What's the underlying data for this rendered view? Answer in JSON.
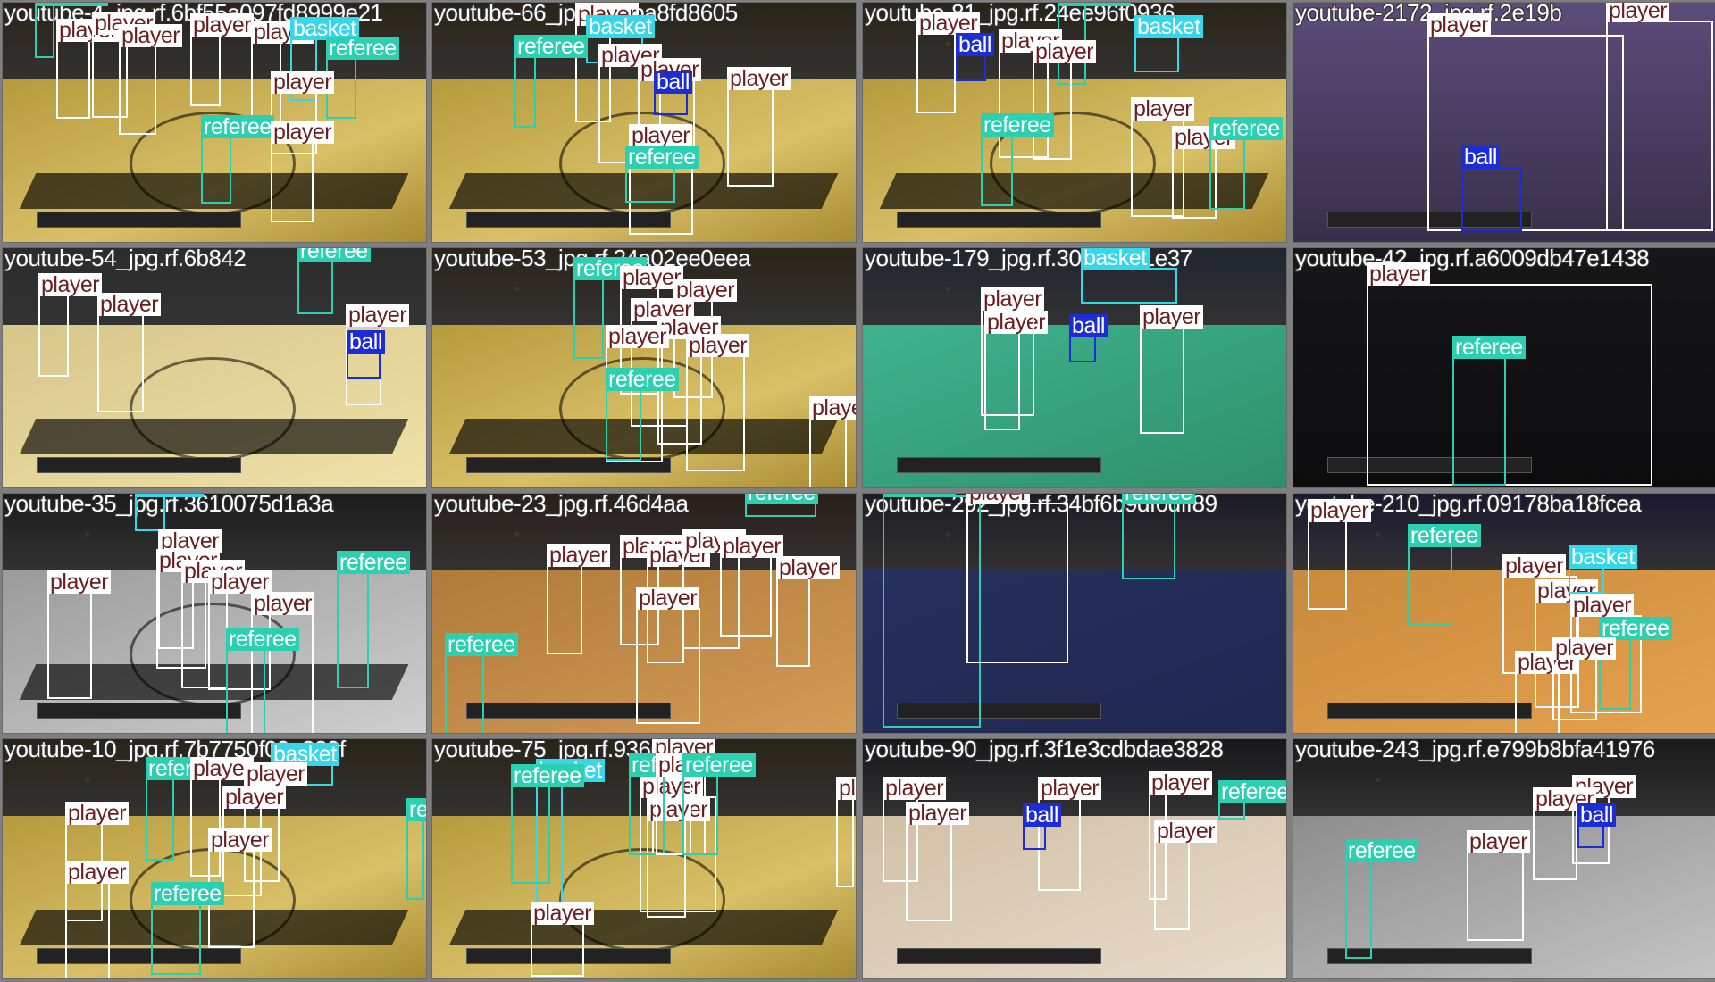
{
  "class_colors": {
    "player": "#ffffff",
    "referee": "#2ad0b0",
    "ball": "#1c2cd6",
    "basket": "#35d8e8"
  },
  "tiles": [
    {
      "name": "youtube-4_jpg.rf.6bf55a097fd8999e21",
      "theme": "gold",
      "detections": [
        {
          "cls": "referee",
          "label": "referee"
        },
        {
          "cls": "player",
          "label": "player"
        },
        {
          "cls": "player",
          "label": "player"
        },
        {
          "cls": "player",
          "label": "player"
        },
        {
          "cls": "player",
          "label": "player"
        },
        {
          "cls": "player",
          "label": "player"
        },
        {
          "cls": "basket",
          "label": "basket"
        },
        {
          "cls": "referee",
          "label": "referee"
        },
        {
          "cls": "player",
          "label": "player"
        },
        {
          "cls": "referee",
          "label": "referee"
        },
        {
          "cls": "player",
          "label": "player"
        }
      ]
    },
    {
      "name": "youtube-66_jpg.rf.dfba8fd8605",
      "theme": "gold",
      "detections": [
        {
          "cls": "player",
          "label": "player"
        },
        {
          "cls": "basket",
          "label": "basket"
        },
        {
          "cls": "referee",
          "label": "referee"
        },
        {
          "cls": "player",
          "label": "player"
        },
        {
          "cls": "player",
          "label": "player"
        },
        {
          "cls": "ball",
          "label": "ball"
        },
        {
          "cls": "player",
          "label": "player"
        },
        {
          "cls": "player",
          "label": "player"
        },
        {
          "cls": "referee",
          "label": "referee"
        }
      ]
    },
    {
      "name": "youtube-81_jpg.rf.24ee96f0936",
      "theme": "gold",
      "detections": [
        {
          "cls": "referee",
          "label": "referee"
        },
        {
          "cls": "player",
          "label": "player"
        },
        {
          "cls": "ball",
          "label": "ball"
        },
        {
          "cls": "player",
          "label": "player"
        },
        {
          "cls": "player",
          "label": "player"
        },
        {
          "cls": "basket",
          "label": "basket"
        },
        {
          "cls": "player",
          "label": "player"
        },
        {
          "cls": "referee",
          "label": "referee"
        },
        {
          "cls": "player",
          "label": "player"
        },
        {
          "cls": "referee",
          "label": "referee"
        }
      ]
    },
    {
      "name": "youtube-2172_jpg.rf.2e19b",
      "theme": "close",
      "detections": [
        {
          "cls": "player",
          "label": "player"
        },
        {
          "cls": "player",
          "label": "player"
        },
        {
          "cls": "ball",
          "label": "ball"
        }
      ]
    },
    {
      "name": "youtube-54_jpg.rf.6b842",
      "theme": "light",
      "detections": [
        {
          "cls": "referee",
          "label": "referee"
        },
        {
          "cls": "player",
          "label": "player"
        },
        {
          "cls": "player",
          "label": "player"
        },
        {
          "cls": "player",
          "label": "player"
        },
        {
          "cls": "ball",
          "label": "ball"
        }
      ]
    },
    {
      "name": "youtube-53_jpg.rf.24a02ee0eea",
      "theme": "gold",
      "detections": [
        {
          "cls": "referee",
          "label": "referee"
        },
        {
          "cls": "player",
          "label": "player"
        },
        {
          "cls": "player",
          "label": "player"
        },
        {
          "cls": "player",
          "label": "player"
        },
        {
          "cls": "player",
          "label": "player"
        },
        {
          "cls": "player",
          "label": "player"
        },
        {
          "cls": "player",
          "label": "player"
        },
        {
          "cls": "referee",
          "label": "referee"
        },
        {
          "cls": "player",
          "label": "player"
        }
      ]
    },
    {
      "name": "youtube-179_jpg.rf.3072cbd1e37",
      "theme": "green",
      "detections": [
        {
          "cls": "basket",
          "label": "basket"
        },
        {
          "cls": "player",
          "label": "player"
        },
        {
          "cls": "player",
          "label": "player"
        },
        {
          "cls": "ball",
          "label": "ball"
        },
        {
          "cls": "player",
          "label": "player"
        }
      ]
    },
    {
      "name": "youtube-42_jpg.rf.a6009db47e1438",
      "theme": "dark",
      "detections": [
        {
          "cls": "player",
          "label": "player"
        },
        {
          "cls": "referee",
          "label": "referee"
        }
      ]
    },
    {
      "name": "youtube-35_jpg.rf.3610075d1a3a",
      "theme": "gray",
      "detections": [
        {
          "cls": "basket",
          "label": "basket"
        },
        {
          "cls": "player",
          "label": "player"
        },
        {
          "cls": "player",
          "label": "player"
        },
        {
          "cls": "player",
          "label": "player"
        },
        {
          "cls": "referee",
          "label": "referee"
        },
        {
          "cls": "player",
          "label": "player"
        },
        {
          "cls": "player",
          "label": "player"
        },
        {
          "cls": "player",
          "label": "player"
        },
        {
          "cls": "referee",
          "label": "referee"
        }
      ]
    },
    {
      "name": "youtube-23_jpg.rf.46d4aa",
      "theme": "wood",
      "detections": [
        {
          "cls": "referee",
          "label": "referee"
        },
        {
          "cls": "player",
          "label": "player"
        },
        {
          "cls": "player",
          "label": "player"
        },
        {
          "cls": "player",
          "label": "player"
        },
        {
          "cls": "player",
          "label": "player"
        },
        {
          "cls": "player",
          "label": "player"
        },
        {
          "cls": "player",
          "label": "player"
        },
        {
          "cls": "player",
          "label": "player"
        },
        {
          "cls": "referee",
          "label": "referee"
        }
      ]
    },
    {
      "name": "youtube-292_jpg.rf.34bf6b9df0dff89",
      "theme": "nba",
      "detections": [
        {
          "cls": "referee",
          "label": "referee"
        },
        {
          "cls": "player",
          "label": "player"
        },
        {
          "cls": "referee",
          "label": "referee"
        }
      ]
    },
    {
      "name": "youtube-210_jpg.rf.09178ba18fcea",
      "theme": "suns",
      "detections": [
        {
          "cls": "player",
          "label": "player"
        },
        {
          "cls": "referee",
          "label": "referee"
        },
        {
          "cls": "player",
          "label": "player"
        },
        {
          "cls": "player",
          "label": "player"
        },
        {
          "cls": "basket",
          "label": "basket"
        },
        {
          "cls": "player",
          "label": "player"
        },
        {
          "cls": "player",
          "label": "player"
        },
        {
          "cls": "referee",
          "label": "referee"
        },
        {
          "cls": "player",
          "label": "player"
        }
      ]
    },
    {
      "name": "youtube-10_jpg.rf.7b7750f09e320f",
      "theme": "gold",
      "detections": [
        {
          "cls": "basket",
          "label": "basket"
        },
        {
          "cls": "referee",
          "label": "referee"
        },
        {
          "cls": "player",
          "label": "player"
        },
        {
          "cls": "player",
          "label": "player"
        },
        {
          "cls": "player",
          "label": "player"
        },
        {
          "cls": "referee",
          "label": "referee"
        },
        {
          "cls": "player",
          "label": "player"
        },
        {
          "cls": "player",
          "label": "player"
        },
        {
          "cls": "player",
          "label": "player"
        },
        {
          "cls": "referee",
          "label": "referee"
        }
      ]
    },
    {
      "name": "youtube-75_jpg.rf.93667b",
      "theme": "gold",
      "detections": [
        {
          "cls": "player",
          "label": "player"
        },
        {
          "cls": "basket",
          "label": "basket"
        },
        {
          "cls": "referee",
          "label": "referee"
        },
        {
          "cls": "player",
          "label": "player"
        },
        {
          "cls": "player",
          "label": "player"
        },
        {
          "cls": "player",
          "label": "player"
        },
        {
          "cls": "player",
          "label": "player"
        },
        {
          "cls": "referee",
          "label": "referee"
        },
        {
          "cls": "player",
          "label": "player"
        },
        {
          "cls": "referee",
          "label": "referee"
        }
      ]
    },
    {
      "name": "youtube-90_jpg.rf.3f1e3cdbdae3828",
      "theme": "pels",
      "detections": [
        {
          "cls": "player",
          "label": "player"
        },
        {
          "cls": "player",
          "label": "player"
        },
        {
          "cls": "player",
          "label": "player"
        },
        {
          "cls": "ball",
          "label": "ball"
        },
        {
          "cls": "player",
          "label": "player"
        },
        {
          "cls": "referee",
          "label": "referee"
        },
        {
          "cls": "player",
          "label": "player"
        }
      ]
    },
    {
      "name": "youtube-243_jpg.rf.e799b8bfa41976",
      "theme": "bw",
      "detections": [
        {
          "cls": "player",
          "label": "player"
        },
        {
          "cls": "player",
          "label": "player"
        },
        {
          "cls": "ball",
          "label": "ball"
        },
        {
          "cls": "referee",
          "label": "referee"
        },
        {
          "cls": "player",
          "label": "player"
        }
      ]
    }
  ]
}
